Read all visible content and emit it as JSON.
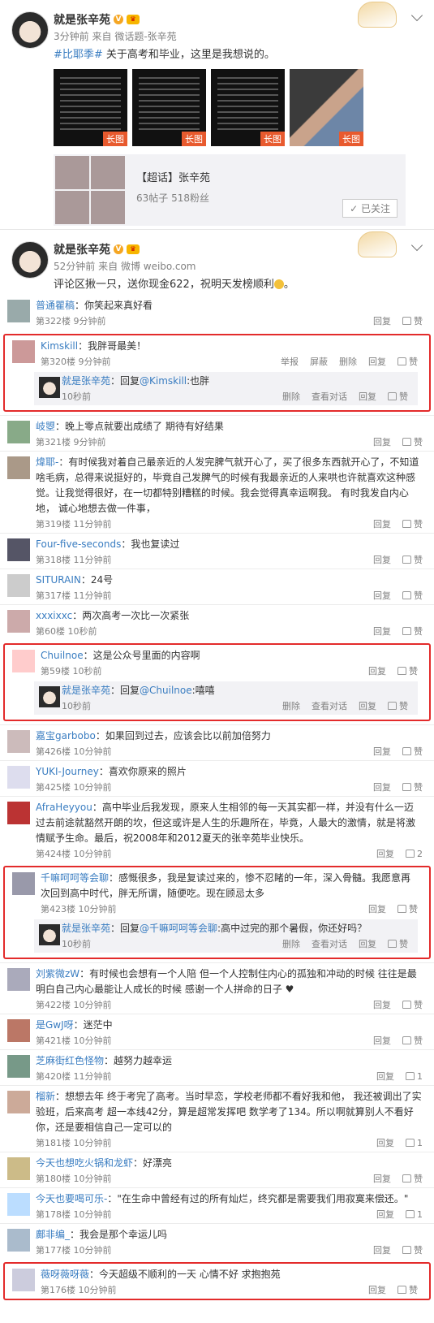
{
  "post1": {
    "user": "就是张辛苑",
    "time": "3分钟前",
    "from": "来自",
    "source": "微话题-张辛苑",
    "hashtag": "#比耶季#",
    "text": " 关于高考和毕业，这里是我想说的。",
    "img_tag": "长图",
    "topic": {
      "title": "【超话】张辛苑",
      "stats": "63帖子 518粉丝",
      "follow": "已关注"
    }
  },
  "post2": {
    "user": "就是张辛苑",
    "time": "52分钟前",
    "from": "来自",
    "source": "微博 weibo.com",
    "text": "评论区揪一只，送你现金622，祝明天发榜顺利"
  },
  "labels": {
    "reply": "回复",
    "like": "赞",
    "report": "举报",
    "block": "屏蔽",
    "delete": "删除",
    "view": "查看对话"
  },
  "comments": [
    {
      "name": "普通瞿稿",
      "text": "：你笑起来真好看",
      "floor": "第322楼",
      "time": "9分钟前",
      "likes": ""
    },
    {
      "name": "Kimskill",
      "text": "：我胖哥最美！",
      "floor": "第320楼",
      "time": "9分钟前",
      "likes": "",
      "ops": true,
      "reply": {
        "name": "就是张辛苑",
        "pre": "：回复",
        "at": "@Kimskill",
        "text": ":也胖",
        "time": "10秒前"
      }
    },
    {
      "name": "岐曌",
      "text": "：晚上零点就要出成绩了 期待有好结果",
      "floor": "第321楼",
      "time": "9分钟前",
      "likes": ""
    },
    {
      "name": "煒耶-",
      "text": "：有时候我对着自己最亲近的人发完脾气就开心了，买了很多东西就开心了，不知道啥毛病，总得来说挺好的，毕竟自己发脾气的时候有我最亲近的人来哄也许就喜欢这种感觉。让我觉得很好，在一切都特别糟糕的时候。我会觉得真幸运啊我。 有时我发自内心地， 诚心地想去做一件事，",
      "floor": "第319楼",
      "time": "11分钟前",
      "likes": ""
    },
    {
      "name": "Four-five-seconds",
      "text": "：我也复读过",
      "floor": "第318楼",
      "time": "11分钟前",
      "likes": ""
    },
    {
      "name": "SITURAIN",
      "text": "：24号",
      "floor": "第317楼",
      "time": "11分钟前",
      "likes": ""
    },
    {
      "name": "xxxixxc",
      "text": "：两次高考一次比一次紧张",
      "floor": "第60楼",
      "time": "10秒前",
      "likes": ""
    },
    {
      "name": "Chuilnoe",
      "text": "：这是公众号里面的内容啊",
      "floor": "第59楼",
      "time": "10秒前",
      "likes": "",
      "reply": {
        "name": "就是张辛苑",
        "pre": "：回复",
        "at": "@Chuilnoe",
        "text": ":嘻嘻",
        "time": "10秒前"
      }
    },
    {
      "name": "嘉宝garbobo",
      "text": "：如果回到过去，应该会比以前加倍努力",
      "floor": "第426楼",
      "time": "10分钟前",
      "likes": ""
    },
    {
      "name": "YUKI-Journey",
      "text": "：喜欢你原来的照片",
      "floor": "第425楼",
      "time": "10分钟前",
      "likes": ""
    },
    {
      "name": "AfraHeyyou",
      "text": "：高中毕业后我发现，原来人生相邻的每一天其实都一样，并没有什么一迈过去前途就豁然开朗的坎，但这或许是人生的乐趣所在，毕竟，人最大的激情，就是将激情赋予生命。最后，祝2008年和2012夏天的张辛苑毕业快乐。",
      "floor": "第424楼",
      "time": "10分钟前",
      "likes": "2"
    },
    {
      "name": "千嘛呵呵等会聊",
      "text": "：感慨很多，我是复读过来的，惨不忍睹的一年，深入骨髓。我愿意再次回到高中时代，胖无所谓，随便吃。现在顾忌太多",
      "floor": "第423楼",
      "time": "10分钟前",
      "likes": "",
      "reply": {
        "name": "就是张辛苑",
        "pre": "：回复",
        "at": "@千嘛呵呵等会聊",
        "text": ":高中过完的那个暑假，你还好吗？",
        "time": "10秒前"
      }
    },
    {
      "name": "刘紫微zW",
      "text": "：有时候也会想有一个人陪 但一个人控制住内心的孤独和冲动的时候 往往是最明白自己内心最能让人成长的时候 感谢一个人拼命的日子 ♥",
      "floor": "第422楼",
      "time": "10分钟前",
      "likes": ""
    },
    {
      "name": "是GwJ呀",
      "text": "：迷茫中",
      "floor": "第421楼",
      "time": "10分钟前",
      "likes": ""
    },
    {
      "name": "芝麻街红色怪物",
      "text": "：越努力越幸运",
      "floor": "第420楼",
      "time": "11分钟前",
      "likes": "1"
    },
    {
      "name": "榴新",
      "text": "：想想去年 终于考完了高考。当时早恋，学校老师都不看好我和他， 我还被调出了实验班，后来高考 超一本线42分，算是超常发挥吧 数学考了134。所以啊就算别人不看好你，还是要相信自己一定可以的",
      "floor": "第181楼",
      "time": "10分钟前",
      "likes": "1"
    },
    {
      "name": "今天也想吃火锅和龙虾",
      "text": "：好漂亮",
      "floor": "第180楼",
      "time": "10分钟前",
      "likes": ""
    },
    {
      "name": "今天也要喝可乐-",
      "text": "：\"在生命中曾经有过的所有灿烂，终究都是需要我们用寂寞来偿还。\"",
      "floor": "第178楼",
      "time": "10分钟前",
      "likes": "1"
    },
    {
      "name": "鄺非编_",
      "text": "：我会是那个幸运儿吗",
      "floor": "第177楼",
      "time": "10分钟前",
      "likes": ""
    },
    {
      "name": "薇呀薇呀薇",
      "text": "：今天超级不顺利的一天 心情不好 求抱抱苑",
      "floor": "第176楼",
      "time": "10分钟前",
      "likes": ""
    }
  ]
}
